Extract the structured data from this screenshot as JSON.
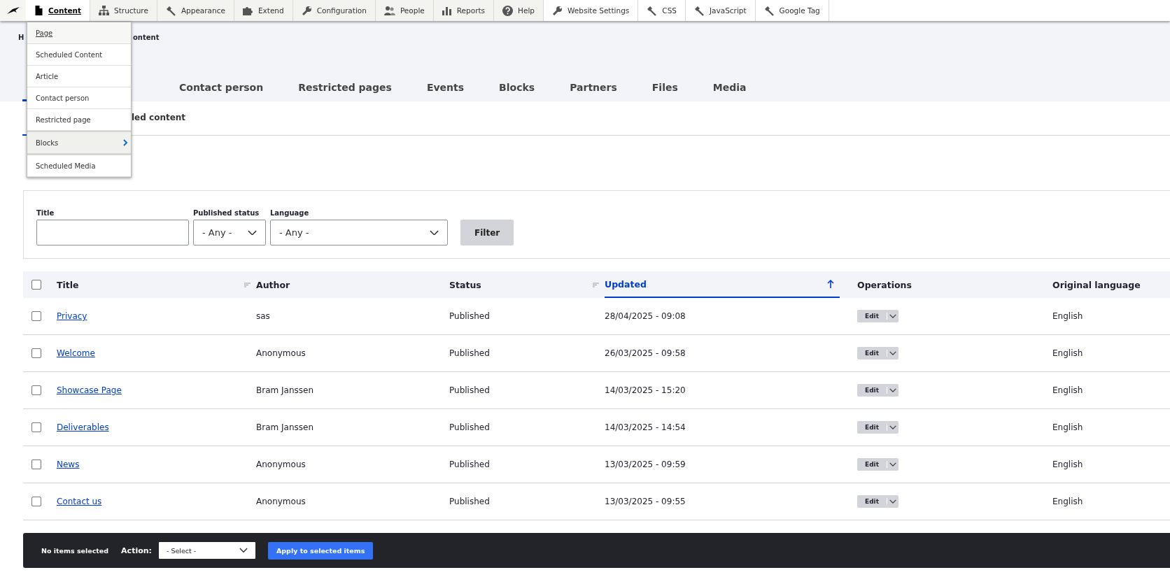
{
  "toolbar": {
    "items": [
      {
        "label": "Content",
        "selected": true
      },
      {
        "label": "Structure",
        "selected": false
      },
      {
        "label": "Appearance",
        "selected": false
      },
      {
        "label": "Extend",
        "selected": false
      },
      {
        "label": "Configuration",
        "selected": false
      },
      {
        "label": "People",
        "selected": false
      },
      {
        "label": "Reports",
        "selected": false
      },
      {
        "label": "Help",
        "selected": false
      },
      {
        "label": "Website Settings",
        "selected": false
      },
      {
        "label": "CSS",
        "selected": false
      },
      {
        "label": "JavaScript",
        "selected": false
      },
      {
        "label": "Google Tag",
        "selected": false
      }
    ]
  },
  "content_menu": {
    "items": [
      {
        "label": "Page",
        "focused": true,
        "hovered": false,
        "has_submenu": false
      },
      {
        "label": "Scheduled Content",
        "focused": false,
        "hovered": false,
        "has_submenu": false
      },
      {
        "label": "Article",
        "focused": false,
        "hovered": false,
        "has_submenu": false
      },
      {
        "label": "Contact person",
        "focused": false,
        "hovered": false,
        "has_submenu": false
      },
      {
        "label": "Restricted page",
        "focused": false,
        "hovered": false,
        "has_submenu": false
      },
      {
        "label": "Blocks",
        "focused": false,
        "hovered": true,
        "has_submenu": true
      },
      {
        "label": "Scheduled Media",
        "focused": false,
        "hovered": false,
        "has_submenu": false
      }
    ]
  },
  "header": {
    "breadcrumb": [
      "H",
      "ontent"
    ],
    "tabs": [
      {
        "label": "Contact person",
        "selected": false
      },
      {
        "label": "Restricted pages",
        "selected": false
      },
      {
        "label": "Events",
        "selected": false
      },
      {
        "label": "Blocks",
        "selected": false
      },
      {
        "label": "Partners",
        "selected": false
      },
      {
        "label": "Files",
        "selected": false
      },
      {
        "label": "Media",
        "selected": false
      }
    ],
    "secondary_tabs": [
      {
        "label": "led content",
        "selected": false
      }
    ]
  },
  "filters": {
    "title": {
      "label": "Title"
    },
    "published_status": {
      "label": "Published status",
      "value": "- Any -"
    },
    "language": {
      "label": "Language",
      "value": "- Any -"
    },
    "button": "Filter"
  },
  "table": {
    "columns": [
      {
        "label": "Title",
        "sortable": true,
        "selected": false
      },
      {
        "label": "Author",
        "sortable": false,
        "selected": false
      },
      {
        "label": "Status",
        "sortable": true,
        "selected": false
      },
      {
        "label": "Updated",
        "sortable": true,
        "selected": true
      },
      {
        "label": "Operations",
        "sortable": false,
        "selected": false
      },
      {
        "label": "Original language",
        "sortable": false,
        "selected": false
      }
    ],
    "select_all_checked": false,
    "rows": [
      {
        "checked": false,
        "title": "Privacy",
        "author": "sas",
        "status": "Published",
        "updated": "28/04/2025 - 09:08",
        "operation": "Edit",
        "language": "English"
      },
      {
        "checked": false,
        "title": "Welcome",
        "author": "Anonymous",
        "status": "Published",
        "updated": "26/03/2025 - 09:58",
        "operation": "Edit",
        "language": "English"
      },
      {
        "checked": false,
        "title": "Showcase Page",
        "author": "Bram Janssen",
        "status": "Published",
        "updated": "14/03/2025 - 15:20",
        "operation": "Edit",
        "language": "English"
      },
      {
        "checked": false,
        "title": "Deliverables",
        "author": "Bram Janssen",
        "status": "Published",
        "updated": "14/03/2025 - 14:54",
        "operation": "Edit",
        "language": "English"
      },
      {
        "checked": false,
        "title": "News",
        "author": "Anonymous",
        "status": "Published",
        "updated": "13/03/2025 - 09:59",
        "operation": "Edit",
        "language": "English"
      },
      {
        "checked": false,
        "title": "Contact us",
        "author": "Anonymous",
        "status": "Published",
        "updated": "13/03/2025 - 09:55",
        "operation": "Edit",
        "language": "English"
      }
    ]
  },
  "bulk_bar": {
    "selection": "No items selected",
    "action_label": "Action:",
    "action_value": "- Select -",
    "button": "Apply to selected items"
  }
}
